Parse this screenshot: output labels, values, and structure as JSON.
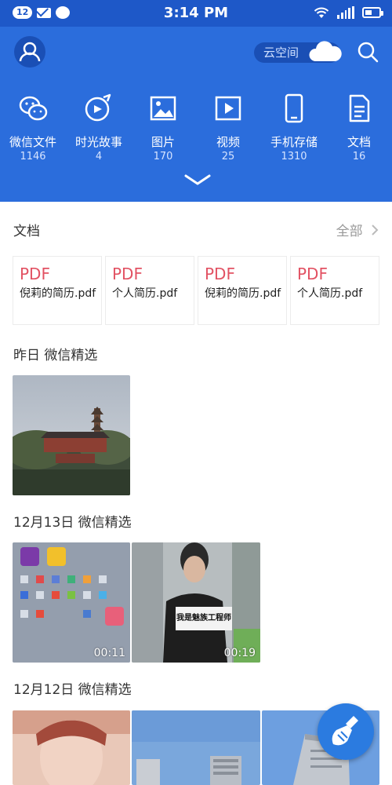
{
  "status_bar": {
    "notification_count": "12",
    "time": "3:14 PM"
  },
  "header": {
    "cloud_label": "云空间",
    "categories": [
      {
        "label": "微信文件",
        "count": "1146",
        "icon": "wechat-icon"
      },
      {
        "label": "时光故事",
        "count": "4",
        "icon": "story-icon"
      },
      {
        "label": "图片",
        "count": "170",
        "icon": "image-icon"
      },
      {
        "label": "视频",
        "count": "25",
        "icon": "video-icon"
      },
      {
        "label": "手机存储",
        "count": "1310",
        "icon": "phone-icon"
      },
      {
        "label": "文档",
        "count": "16",
        "icon": "document-icon"
      }
    ]
  },
  "documents": {
    "title": "文档",
    "see_all": "全部",
    "items": [
      {
        "type": "PDF",
        "name": "倪莉的简历.pdf"
      },
      {
        "type": "PDF",
        "name": "个人简历.pdf"
      },
      {
        "type": "PDF",
        "name": "倪莉的简历.pdf"
      },
      {
        "type": "PDF",
        "name": "个人简历.pdf"
      }
    ]
  },
  "groups": [
    {
      "title": "昨日 微信精选"
    },
    {
      "title": "12月13日 微信精选",
      "durations": [
        "00:11",
        "00:19"
      ],
      "sign_text": "我是魅族工程师"
    },
    {
      "title": "12月12日 微信精选"
    }
  ],
  "colors": {
    "header_blue": "#2b6ddc",
    "statusbar_blue": "#1e58c8",
    "pdf_red": "#e25263"
  }
}
